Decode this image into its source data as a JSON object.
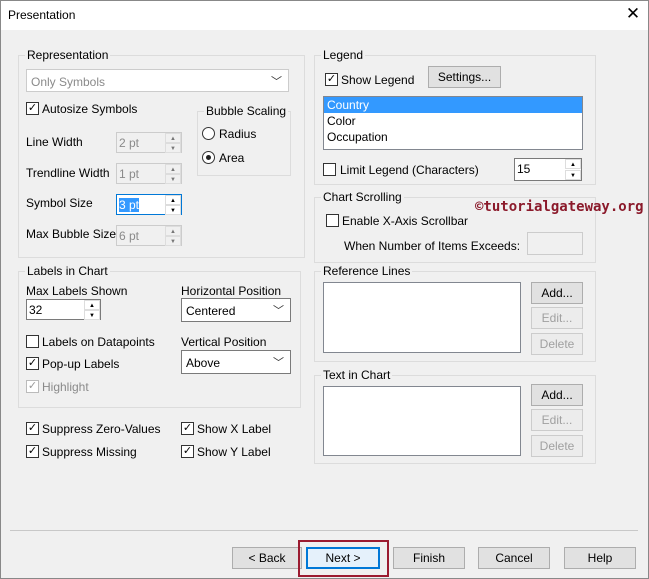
{
  "window": {
    "title": "Presentation",
    "close": "✕"
  },
  "representation": {
    "title": "Representation",
    "combo_value": "Only Symbols",
    "autosize": "Autosize Symbols",
    "line_width": {
      "label": "Line Width",
      "value": "2 pt"
    },
    "trendline_width": {
      "label": "Trendline Width",
      "value": "1 pt"
    },
    "symbol_size": {
      "label": "Symbol Size",
      "value": "3 pt"
    },
    "max_bubble": {
      "label": "Max Bubble Size",
      "value": "6 pt"
    },
    "bubble_scaling": {
      "title": "Bubble Scaling",
      "radius": "Radius",
      "area": "Area"
    }
  },
  "labels": {
    "title": "Labels in Chart",
    "max_labels_label": "Max Labels Shown",
    "max_labels_value": "32",
    "horizontal_label": "Horizontal Position",
    "horizontal_value": "Centered",
    "vertical_label": "Vertical Position",
    "vertical_value": "Above",
    "on_datapoints": "Labels on Datapoints",
    "popup": "Pop-up Labels",
    "highlight": "Highlight"
  },
  "options": {
    "suppress_zero": "Suppress Zero-Values",
    "suppress_missing": "Suppress Missing",
    "show_x": "Show X Label",
    "show_y": "Show Y Label"
  },
  "legend": {
    "title": "Legend",
    "show_legend": "Show Legend",
    "settings": "Settings...",
    "items": [
      "Country",
      "Color",
      "Occupation"
    ],
    "limit": "Limit Legend (Characters)",
    "limit_value": "15"
  },
  "scrolling": {
    "title": "Chart Scrolling",
    "enable": "Enable X-Axis Scrollbar",
    "exceeds": "When Number of Items Exceeds:"
  },
  "watermark": "©tutorialgateway.org",
  "reference": {
    "title": "Reference Lines",
    "add": "Add...",
    "edit": "Edit...",
    "delete": "Delete"
  },
  "text_in_chart": {
    "title": "Text in Chart",
    "add": "Add...",
    "edit": "Edit...",
    "delete": "Delete"
  },
  "footer": {
    "back": "< Back",
    "next": "Next >",
    "finish": "Finish",
    "cancel": "Cancel",
    "help": "Help"
  },
  "colors": {
    "selection": "#3399ff",
    "highlight_box": "#9b1b30",
    "watermark": "#8b1a2b"
  }
}
